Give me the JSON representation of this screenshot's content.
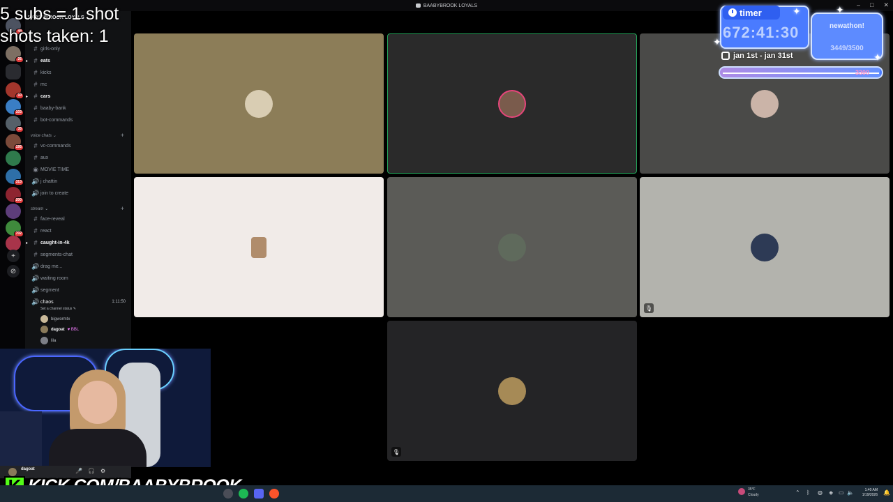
{
  "window": {
    "title": "BAABYBROOK LOYALS",
    "controls": [
      "–",
      "□",
      "✕"
    ]
  },
  "overlay": {
    "subs_rule": "5 subs = 1 shot",
    "shots_taken": "shots taken: 1"
  },
  "server_rail": {
    "badges": [
      "44",
      "26",
      "",
      "10",
      "103",
      "35",
      "195",
      "",
      "313",
      "200",
      "",
      "702",
      "",
      ""
    ],
    "add_label": "+",
    "explore_label": "⊘"
  },
  "channel_list": {
    "server_name": "BAABYBROOK LOYALS",
    "text_channels": [
      {
        "label": "girls-only",
        "symbol": "#",
        "bold": false
      },
      {
        "label": "eats",
        "symbol": "#",
        "bold": true,
        "arrow": true
      },
      {
        "label": "kicks",
        "symbol": "#",
        "bold": false
      },
      {
        "label": "mc",
        "symbol": "#",
        "bold": false
      },
      {
        "label": "cars",
        "symbol": "#",
        "bold": true,
        "arrow": true
      },
      {
        "label": "baaby-bank",
        "symbol": "#",
        "bold": false
      },
      {
        "label": "bot-commands",
        "symbol": "#",
        "bold": false
      }
    ],
    "voice_category": "voice chats",
    "voice_channels": [
      {
        "label": "vc-commands",
        "symbol": "#"
      },
      {
        "label": "aux",
        "symbol": "#"
      },
      {
        "label": "MOVIE TIME",
        "symbol": "◉"
      },
      {
        "label": "j chattin",
        "symbol": "🔊"
      },
      {
        "label": "join to create",
        "symbol": "🔊"
      }
    ],
    "stream_category": "stream",
    "stream_channels": [
      {
        "label": "face-reveal",
        "symbol": "#",
        "bold": false
      },
      {
        "label": "react",
        "symbol": "#",
        "bold": false
      },
      {
        "label": "caught-in-4k",
        "symbol": "#",
        "bold": true,
        "arrow": true
      },
      {
        "label": "segments-chat",
        "symbol": "#",
        "bold": false
      },
      {
        "label": "drag me...",
        "symbol": "🔊",
        "bold": false
      },
      {
        "label": "waiting room",
        "symbol": "🔊",
        "bold": false
      },
      {
        "label": "segment",
        "symbol": "🔊",
        "bold": false
      }
    ],
    "active_voice": {
      "label": "chaos",
      "elapsed": "1:11:50",
      "status": "Set a channel status ✎"
    },
    "members": [
      {
        "name": "bigwormtx",
        "tag": ""
      },
      {
        "name": "dagoat",
        "tag": "♥ BBL"
      },
      {
        "name": "lila",
        "tag": ""
      }
    ]
  },
  "tiles": [
    {
      "bg": "#8c7d58",
      "avatar": "#d9cdb3",
      "speaking": false,
      "muted": false
    },
    {
      "bg": "#2a2a2a",
      "avatar": "#7a5b4c",
      "speaking": true,
      "muted": false
    },
    {
      "bg": "#4a4a48",
      "avatar": "#cbb4a8",
      "speaking": false,
      "muted": false
    },
    {
      "bg": "#f1ebe8",
      "avatar": "#b08c6b",
      "speaking": false,
      "muted": false
    },
    {
      "bg": "#5b5b57",
      "avatar": "#5f6a5c",
      "speaking": false,
      "muted": false
    },
    {
      "bg": "#b3b3ad",
      "avatar": "#2d3a55",
      "speaking": false,
      "muted": true
    },
    {
      "bg": "#242426",
      "avatar": "#a68a56",
      "speaking": false,
      "muted": true
    }
  ],
  "user_panel": {
    "name": "dagoat",
    "icons": [
      "🎤",
      "🎧",
      "⚙"
    ]
  },
  "kick": {
    "letter": "K",
    "url": "KICK.COM/BAABYBROOK"
  },
  "widgets": {
    "timer_label": "timer",
    "timer_value": "672:41:30",
    "subathon_title": "newathon!",
    "subathon_count": "3449/3500",
    "date_range": "jan 1st - jan 31st",
    "progress_goal": "3300",
    "progress_fraction": 0.985
  },
  "taskbar": {
    "weather_temp": "35°F",
    "weather_desc": "Cloudy",
    "time": "1:40 AM",
    "date": "1/19/2026"
  },
  "colors": {
    "accent": "#4a7bff",
    "speaking": "#23a55a",
    "kick": "#53fc18"
  }
}
